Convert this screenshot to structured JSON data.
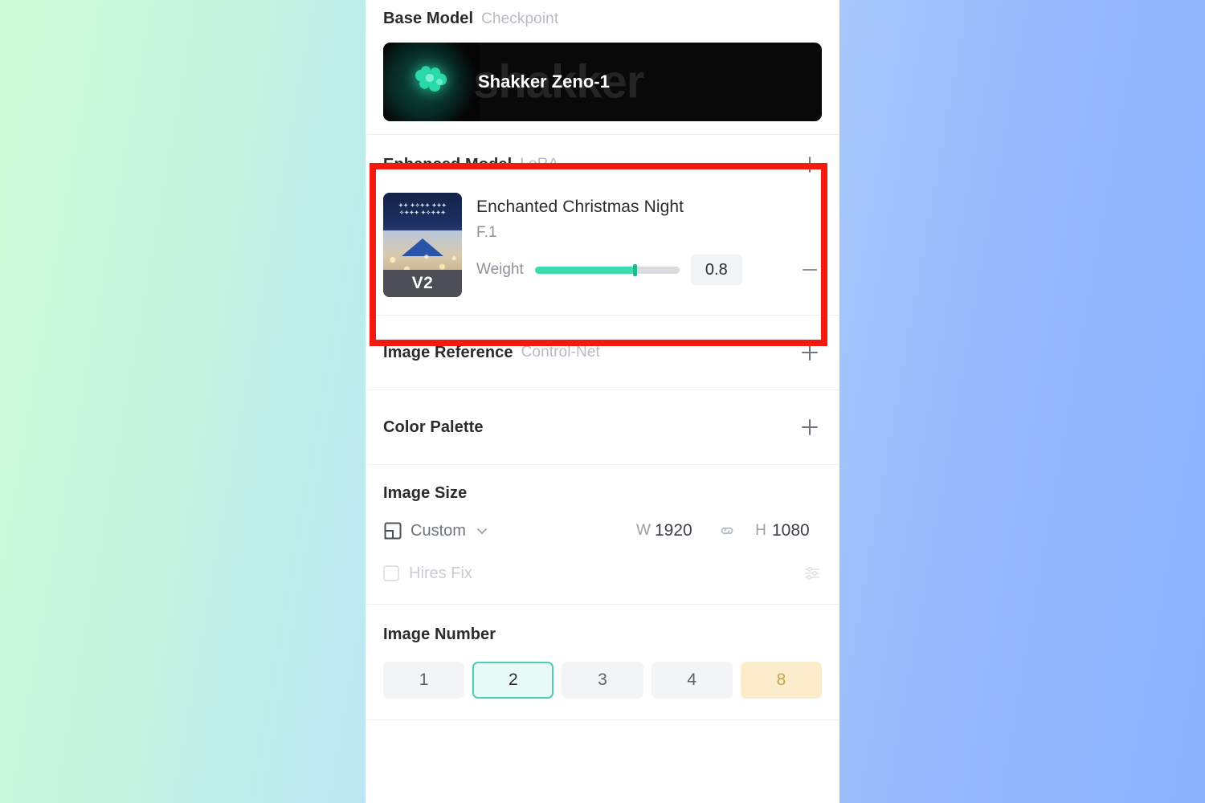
{
  "base_model": {
    "title": "Base Model",
    "subtitle": "Checkpoint",
    "card": {
      "name": "Shakker Zeno-1",
      "watermark": "shakker",
      "logo_icon": "shakker-logo-icon"
    }
  },
  "enhanced_model": {
    "title": "Enhanced Model",
    "subtitle": "LoRA",
    "add_icon": "plus-icon",
    "lora": {
      "name": "Enchanted Christmas Night",
      "base": "F.1",
      "version_badge": "V2",
      "weight_label": "Weight",
      "weight_value": "0.8",
      "weight_fraction": 0.69,
      "remove_icon": "minus-icon"
    },
    "highlight_color": "#f51a10"
  },
  "image_reference": {
    "title": "Image Reference",
    "subtitle": "Control-Net",
    "add_icon": "plus-icon"
  },
  "color_palette": {
    "title": "Color Palette",
    "subtitle": "",
    "add_icon": "plus-icon"
  },
  "image_size": {
    "title": "Image Size",
    "ratio_icon": "aspect-ratio-icon",
    "ratio_label": "Custom",
    "chevron_icon": "chevron-down-icon",
    "width_label": "W",
    "width_value": "1920",
    "link_icon": "link-chain-icon",
    "height_label": "H",
    "height_value": "1080",
    "hires_label": "Hires Fix",
    "hires_checked": false,
    "hires_settings_icon": "sliders-icon"
  },
  "image_number": {
    "title": "Image Number",
    "options": [
      {
        "label": "1",
        "state": "default"
      },
      {
        "label": "2",
        "state": "selected"
      },
      {
        "label": "3",
        "state": "default"
      },
      {
        "label": "4",
        "state": "default"
      },
      {
        "label": "8",
        "state": "premium"
      }
    ]
  },
  "theme": {
    "accent_teal": "#3ddbb0",
    "selected_border": "#4dcfb4",
    "premium_bg": "#fbeccc",
    "premium_text": "#c9a24a",
    "highlight_red": "#f51a10",
    "panel_bg": "#ffffff"
  }
}
